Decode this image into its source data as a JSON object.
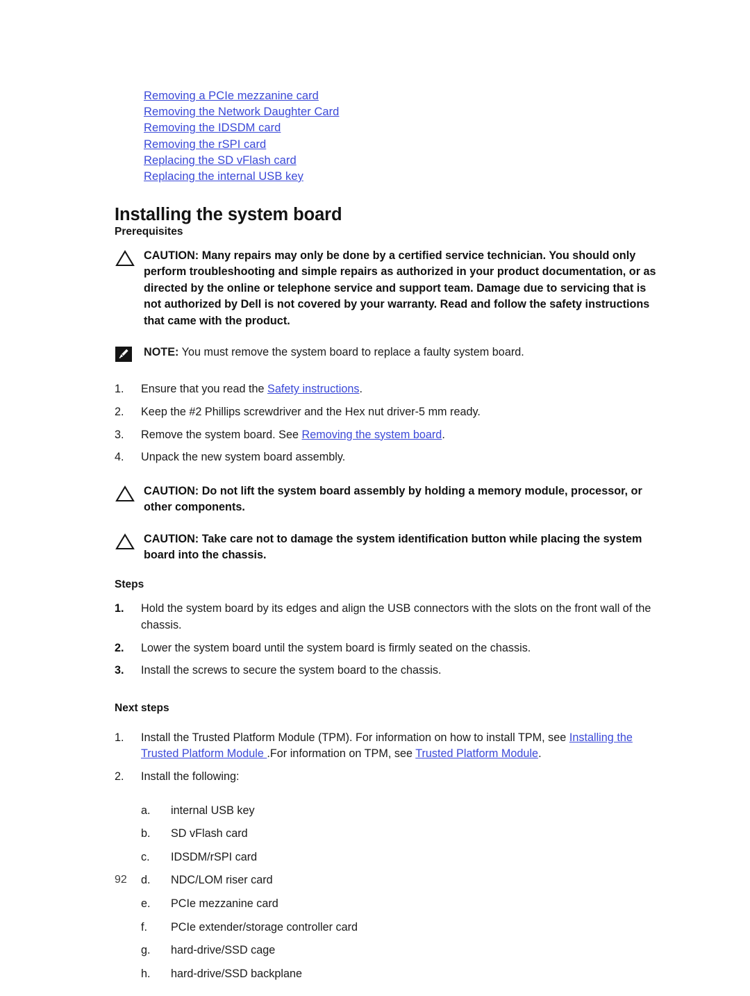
{
  "document": {
    "page_number": "92",
    "link_color": "#3b49d8",
    "text_color": "#1a1a1a"
  },
  "related_links": [
    {
      "label": "Removing a PCIe mezzanine card"
    },
    {
      "label": "Removing the Network Daughter Card"
    },
    {
      "label": "Removing the IDSDM card"
    },
    {
      "label": "Removing the rSPI card"
    },
    {
      "label": "Replacing the SD vFlash card"
    },
    {
      "label": "Replacing the internal USB key"
    }
  ],
  "title": "Installing the system board",
  "prerequisites": {
    "heading": "Prerequisites",
    "caution_main": {
      "icon": "warning-triangle-icon",
      "text": "CAUTION: Many repairs may only be done by a certified service technician. You should only perform troubleshooting and simple repairs as authorized in your product documentation, or as directed by the online or telephone service and support team. Damage due to servicing that is not authorized by Dell is not covered by your warranty. Read and follow the safety instructions that came with the product."
    },
    "note": {
      "icon": "note-pencil-icon",
      "lead": "NOTE:",
      "text": " You must remove the system board to replace a faulty system board."
    },
    "steps": [
      {
        "marker": "1.",
        "prefix": "Ensure that you read the ",
        "link": "Safety instructions",
        "suffix": "."
      },
      {
        "marker": "2.",
        "prefix": "Keep the #2 Phillips screwdriver and the Hex nut driver-5 mm ready.",
        "link": "",
        "suffix": ""
      },
      {
        "marker": "3.",
        "prefix": "Remove the system board. See ",
        "link": "Removing the system board",
        "suffix": "."
      },
      {
        "marker": "4.",
        "prefix": "Unpack the new system board assembly.",
        "link": "",
        "suffix": ""
      }
    ],
    "caution_lift": {
      "icon": "warning-triangle-icon",
      "text": "CAUTION: Do not lift the system board assembly by holding a memory module, processor, or other components."
    },
    "caution_button": {
      "icon": "warning-triangle-icon",
      "text": "CAUTION: Take care not to damage the system identification button while placing the system board into the chassis."
    }
  },
  "steps_section": {
    "heading": "Steps",
    "items": [
      {
        "marker": "1.",
        "text": "Hold the system board by its edges and align the USB connectors with the slots on the front wall of the chassis."
      },
      {
        "marker": "2.",
        "text": "Lower the system board until the system board is firmly seated on the chassis."
      },
      {
        "marker": "3.",
        "text": "Install the screws to secure the system board to the chassis."
      }
    ]
  },
  "next_steps_section": {
    "heading": "Next steps",
    "item1": {
      "marker": "1.",
      "part1": "Install the Trusted Platform Module (TPM). For information on how to install TPM, see ",
      "link1": "Installing the Trusted Platform Module ",
      "part2": ".For information on TPM, see ",
      "link2": "Trusted Platform Module",
      "part3": "."
    },
    "item2": {
      "marker": "2.",
      "text": "Install the following:"
    },
    "sub_items": [
      {
        "marker": "a.",
        "label": "internal USB key"
      },
      {
        "marker": "b.",
        "label": "SD vFlash card"
      },
      {
        "marker": "c.",
        "label": "IDSDM/rSPI card"
      },
      {
        "marker": "d.",
        "label": "NDC/LOM riser card"
      },
      {
        "marker": "e.",
        "label": "PCIe mezzanine card"
      },
      {
        "marker": "f.",
        "label": "PCIe extender/storage controller card"
      },
      {
        "marker": "g.",
        "label": "hard-drive/SSD cage"
      },
      {
        "marker": "h.",
        "label": "hard-drive/SSD backplane"
      }
    ]
  }
}
